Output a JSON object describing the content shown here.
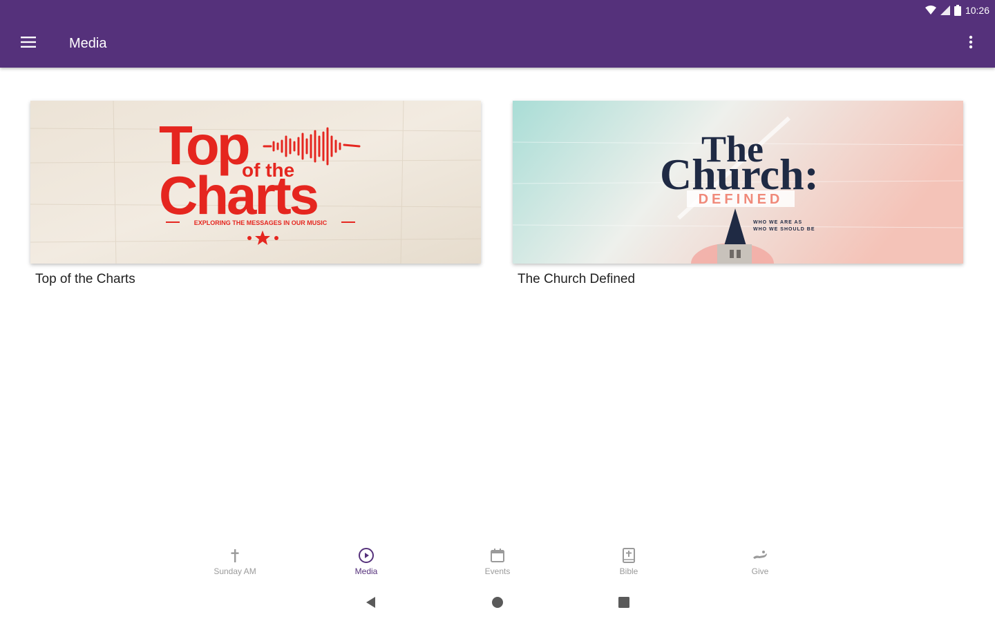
{
  "status": {
    "time": "10:26"
  },
  "appbar": {
    "title": "Media"
  },
  "cards": [
    {
      "label": "Top of the Charts",
      "art": {
        "line1": "Top",
        "line2": "of the",
        "line3": "Charts",
        "tagline": "EXPLORING THE MESSAGES IN OUR MUSIC",
        "color": "#e5261f"
      }
    },
    {
      "label": "The Church Defined",
      "art": {
        "line1": "The",
        "line2": "Church:",
        "line3": "DEFINED",
        "small1": "WHO WE ARE AS",
        "small2": "WHO WE SHOULD BE",
        "color": "#1f2a44"
      }
    }
  ],
  "bottom_nav": [
    {
      "label": "Sunday AM",
      "icon": "cross-icon"
    },
    {
      "label": "Media",
      "icon": "play-circle-icon",
      "active": true
    },
    {
      "label": "Events",
      "icon": "calendar-icon"
    },
    {
      "label": "Bible",
      "icon": "bible-icon"
    },
    {
      "label": "Give",
      "icon": "give-hand-icon"
    }
  ],
  "colors": {
    "primary": "#55317b",
    "inactive": "#9a9a9a"
  }
}
